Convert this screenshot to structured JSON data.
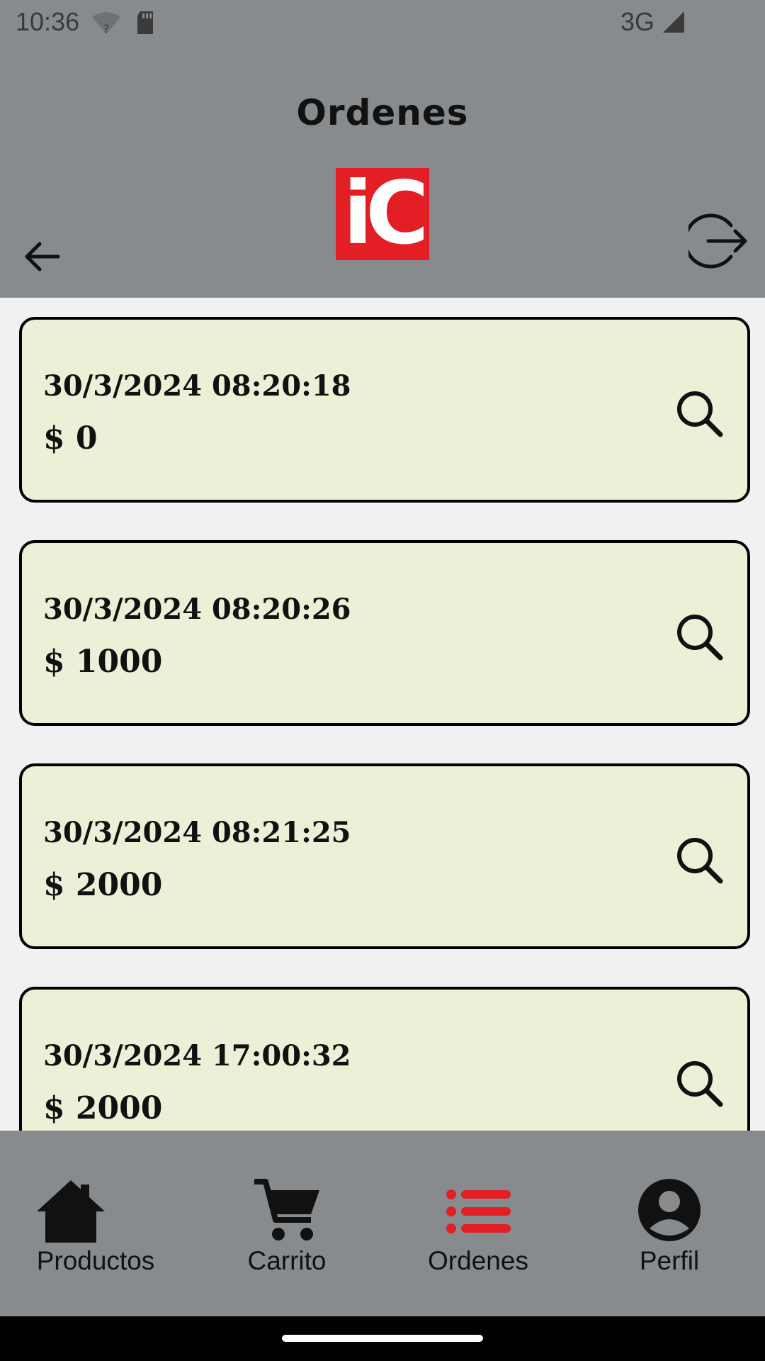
{
  "status_bar": {
    "time": "10:36",
    "network": "3G",
    "icons": [
      "wifi-unknown-icon",
      "sd-card-icon",
      "signal-icon"
    ]
  },
  "header": {
    "title": "Ordenes",
    "logo_text": "iC",
    "logo_color": "#e31e24",
    "icons": [
      "back-arrow-icon",
      "logout-icon"
    ]
  },
  "orders": [
    {
      "date": "30/3/2024  08:20:18",
      "total": "$ 0"
    },
    {
      "date": "30/3/2024  08:20:26",
      "total": "$ 1000"
    },
    {
      "date": "30/3/2024  08:21:25",
      "total": "$ 2000"
    },
    {
      "date": "30/3/2024  17:00:32",
      "total": "$ 2000"
    }
  ],
  "bottom_nav": {
    "items": [
      {
        "label": "Productos",
        "icon": "home-icon"
      },
      {
        "label": "Carrito",
        "icon": "cart-icon"
      },
      {
        "label": "Ordenes",
        "icon": "list-icon",
        "active": true
      },
      {
        "label": "Perfil",
        "icon": "account-icon"
      }
    ],
    "active_color": "#e31e24"
  }
}
